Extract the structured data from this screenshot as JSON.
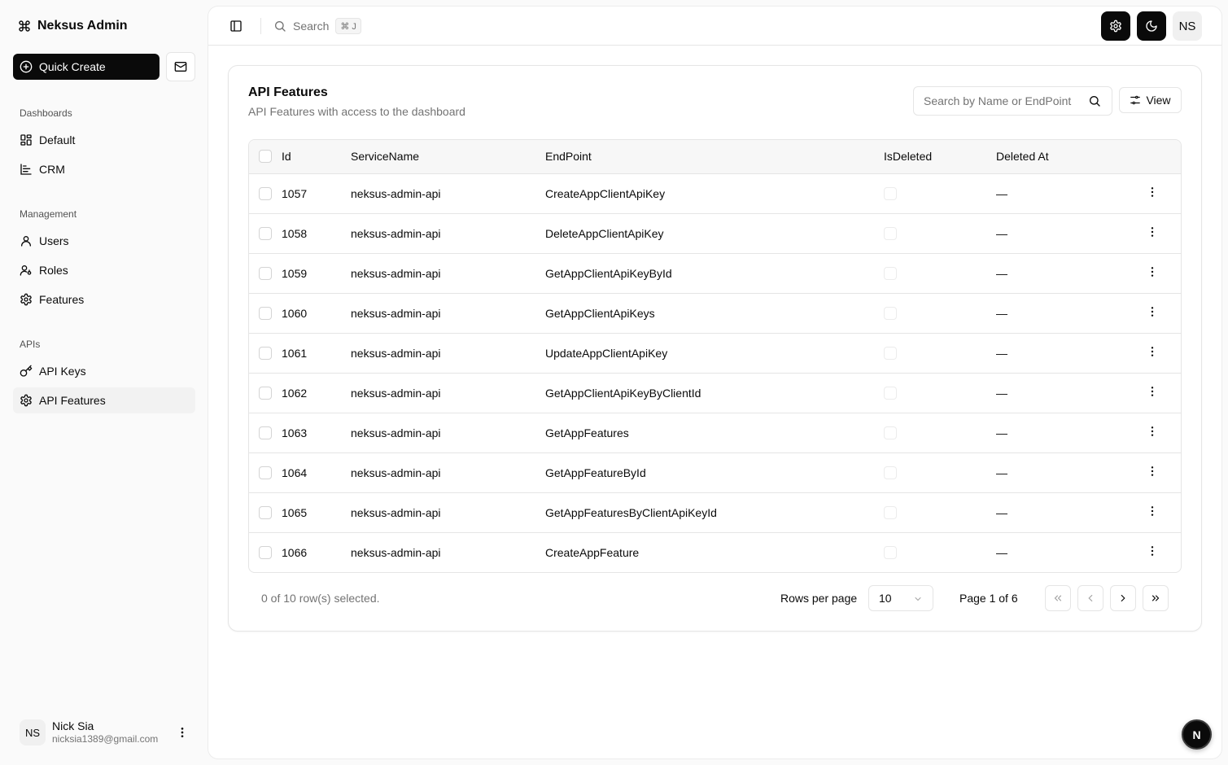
{
  "app": {
    "title": "Neksus Admin"
  },
  "sidebar": {
    "quick_create": "Quick Create",
    "groups": [
      {
        "label": "Dashboards",
        "items": [
          {
            "label": "Default",
            "icon": "layout-grid-icon"
          },
          {
            "label": "CRM",
            "icon": "chart-icon"
          }
        ]
      },
      {
        "label": "Management",
        "items": [
          {
            "label": "Users",
            "icon": "user-icon"
          },
          {
            "label": "Roles",
            "icon": "user-key-icon"
          },
          {
            "label": "Features",
            "icon": "settings-icon"
          }
        ]
      },
      {
        "label": "APIs",
        "items": [
          {
            "label": "API Keys",
            "icon": "key-icon"
          },
          {
            "label": "API Features",
            "icon": "settings-icon",
            "active": true
          }
        ]
      }
    ],
    "user": {
      "initials": "NS",
      "name": "Nick Sia",
      "email": "nicksia1389@gmail.com"
    }
  },
  "header": {
    "search_label": "Search",
    "search_shortcut": "⌘ J",
    "avatar_initials": "NS"
  },
  "card": {
    "title": "API Features",
    "description": "API Features with access to the dashboard",
    "filter_placeholder": "Search by Name or EndPoint",
    "view_label": "View"
  },
  "table": {
    "columns": [
      "Id",
      "ServiceName",
      "EndPoint",
      "IsDeleted",
      "Deleted At"
    ],
    "rows": [
      {
        "id": "1057",
        "service": "neksus-admin-api",
        "endpoint": "CreateAppClientApiKey",
        "deleted_at": "—"
      },
      {
        "id": "1058",
        "service": "neksus-admin-api",
        "endpoint": "DeleteAppClientApiKey",
        "deleted_at": "—"
      },
      {
        "id": "1059",
        "service": "neksus-admin-api",
        "endpoint": "GetAppClientApiKeyById",
        "deleted_at": "—"
      },
      {
        "id": "1060",
        "service": "neksus-admin-api",
        "endpoint": "GetAppClientApiKeys",
        "deleted_at": "—"
      },
      {
        "id": "1061",
        "service": "neksus-admin-api",
        "endpoint": "UpdateAppClientApiKey",
        "deleted_at": "—"
      },
      {
        "id": "1062",
        "service": "neksus-admin-api",
        "endpoint": "GetAppClientApiKeyByClientId",
        "deleted_at": "—"
      },
      {
        "id": "1063",
        "service": "neksus-admin-api",
        "endpoint": "GetAppFeatures",
        "deleted_at": "—"
      },
      {
        "id": "1064",
        "service": "neksus-admin-api",
        "endpoint": "GetAppFeatureById",
        "deleted_at": "—"
      },
      {
        "id": "1065",
        "service": "neksus-admin-api",
        "endpoint": "GetAppFeaturesByClientApiKeyId",
        "deleted_at": "—"
      },
      {
        "id": "1066",
        "service": "neksus-admin-api",
        "endpoint": "CreateAppFeature",
        "deleted_at": "—"
      }
    ]
  },
  "pagination": {
    "selected_text": "0 of 10 row(s) selected.",
    "rows_per_page_label": "Rows per page",
    "rows_per_page_value": "10",
    "page_text": "Page 1 of 6"
  },
  "fab": {
    "label": "N"
  }
}
